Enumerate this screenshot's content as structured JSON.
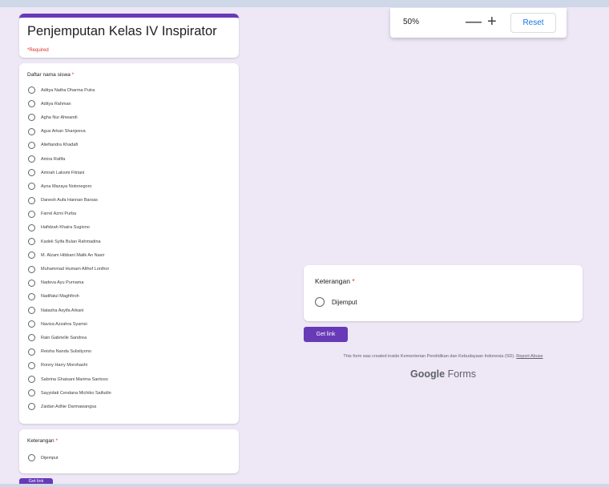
{
  "form": {
    "title": "Penjemputan Kelas IV Inspirator",
    "required_note": "*Required"
  },
  "question1": {
    "label": "Daftar nama siswa",
    "required_mark": "*",
    "options": [
      "Aditya Natha Dharma Putra",
      "Aditya Rahman",
      "Agha Nur Ahwandi",
      "Agus Arkan Shanjeeva",
      "Aliefiandra Khadafi",
      "Amira Rafifa",
      "Amirah Laksmi Fitriani",
      "Ayna Mazaya Notonegoro",
      "Danesh Aufa Hannan Barsas",
      "Farrel Azmi Purba",
      "Hafidzah Khaira Sugiono",
      "Kadek Syifa Bulan Rahmadina",
      "M. Alzam Hibbani Malik An Nasir",
      "Muhammad Humam Althof Lonthor",
      "Nadeva Ayu Purnama",
      "Nadifatul Maghfiroh",
      "Natasha Asyifa Arkani",
      "Naviza Azzahra Syamsi",
      "Rain Gabrielle Sandrea",
      "Reisha Nanda Sulistiyono",
      "Ronny Harry Morohashi",
      "Sabrina Ghaisani Marima Santoso",
      "Sayyidati Cendana Michiko Saifudin",
      "Zaidan Adhie Darmawangsa"
    ]
  },
  "question2": {
    "label": "Keterangan",
    "required_mark": "*",
    "options": [
      "Dijemput"
    ]
  },
  "zoom": {
    "level": "50%",
    "minus": "—",
    "plus": "+",
    "reset": "Reset"
  },
  "get_link_label": "Get link",
  "footer": {
    "note": "This form was created inside Kementerian Pendidikan dan Kebudayaan Indonesia (SD).",
    "report": "Report Abuse",
    "brand_google": "Google",
    "brand_forms": "Forms"
  },
  "colors": {
    "accent": "#673ab7",
    "background": "#ede7f6",
    "required": "#d93025",
    "link": "#1a73e8"
  }
}
